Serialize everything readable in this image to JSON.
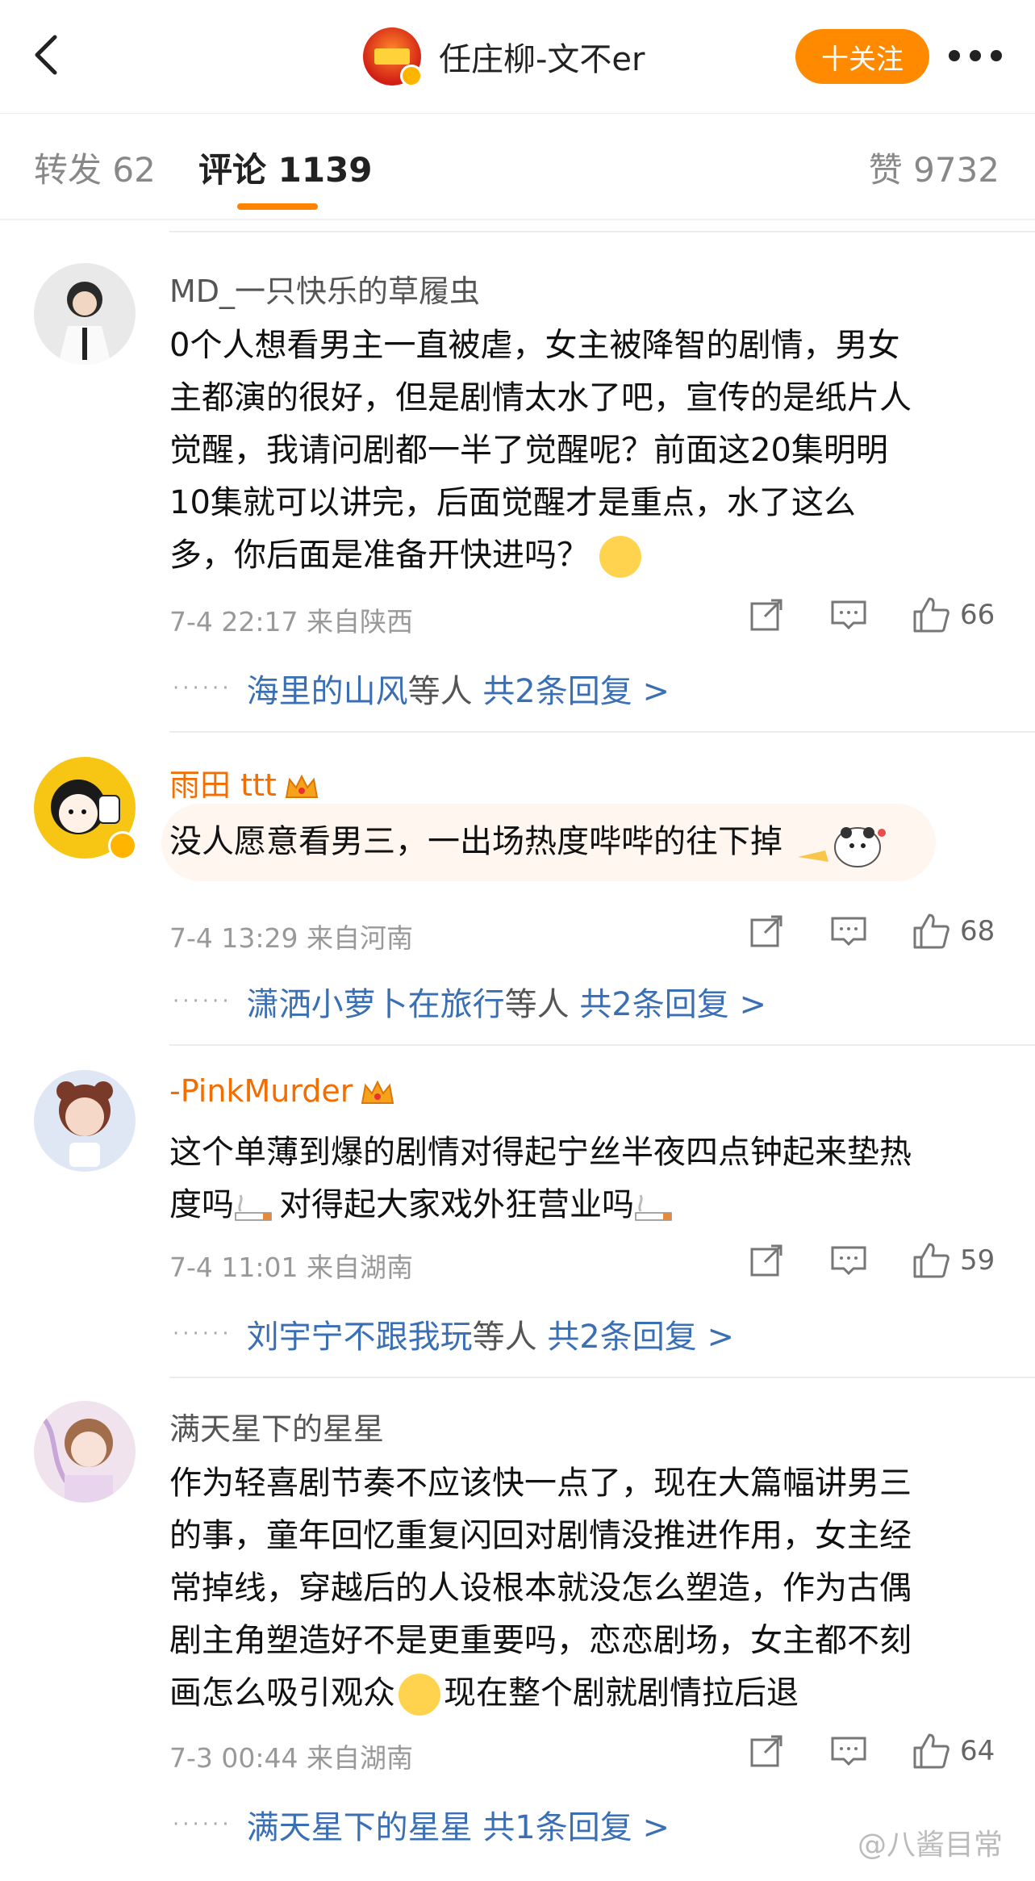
{
  "header": {
    "account_name": "任庄柳-文不er",
    "follow_label": "十关注"
  },
  "tabs": {
    "repost": "转发 62",
    "comments": "评论 1139",
    "likes": "赞 9732"
  },
  "comments": [
    {
      "user": "MD_一只快乐的草履虫",
      "text_lines": [
        "0个人想看男主一直被虐，女主被降智的剧情，男女",
        "主都演的很好，但是剧情太水了吧，宣传的是纸片人",
        "觉醒，我请问剧都一半了觉醒呢？前面这20集明明",
        "10集就可以讲完，后面觉醒才是重点，水了这么",
        "多，你后面是准备开快进吗？"
      ],
      "time_location": "7-4 22:17  来自陕西",
      "likes": "66",
      "reply_user": "海里的山风",
      "reply_suffix": "等人",
      "reply_count": "共2条回复 >"
    },
    {
      "user": "雨田 ttt",
      "text_lines": [
        "没人愿意看男三，一出场热度哔哔的往下掉"
      ],
      "time_location": "7-4 13:29  来自河南",
      "likes": "68",
      "reply_user": "潇洒小萝卜在旅行",
      "reply_suffix": "等人",
      "reply_count": "共2条回复 >"
    },
    {
      "user": "-PinkMurder",
      "text_lines": [
        "这个单薄到爆的剧情对得起宁丝半夜四点钟起来垫热",
        "度吗",
        "对得起大家戏外狂营业吗"
      ],
      "time_location": "7-4 11:01  来自湖南",
      "likes": "59",
      "reply_user": "刘宇宁不跟我玩",
      "reply_suffix": "等人",
      "reply_count": "共2条回复 >"
    },
    {
      "user": "满天星下的星星",
      "text_lines": [
        "作为轻喜剧节奏不应该快一点了，现在大篇幅讲男三",
        "的事，童年回忆重复闪回对剧情没推进作用，女主经",
        "常掉线，穿越后的人设根本就没怎么塑造，作为古偶",
        "剧主角塑造好不是更重要吗，恋恋剧场，女主都不刻",
        "画怎么吸引观众",
        "现在整个剧就剧情拉后退"
      ],
      "time_location": "7-3 00:44  来自湖南",
      "likes": "64",
      "reply_user": "满天星下的星星",
      "reply_suffix": "",
      "reply_count": "共1条回复 >"
    }
  ],
  "watermark": "@八酱目常",
  "colors": {
    "accent": "#ff8200",
    "link": "#3b6fb4",
    "vip_name": "#f36d00"
  }
}
